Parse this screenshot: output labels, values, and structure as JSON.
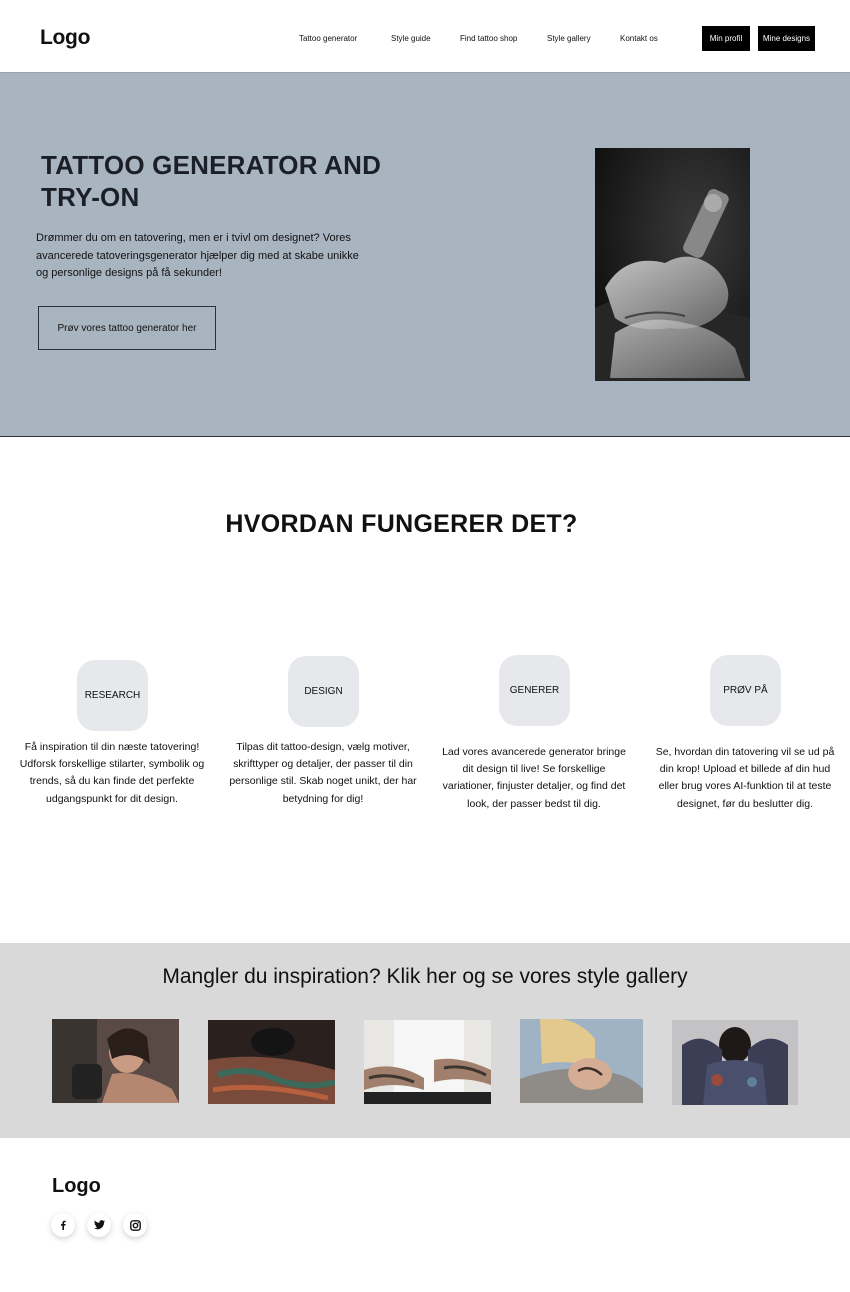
{
  "header": {
    "logo": "Logo",
    "nav": [
      "Tattoo generator",
      "Style guide",
      "Find tattoo shop",
      "Style gallery",
      "Kontakt os"
    ],
    "profile_button": "Min profil",
    "designs_button": "Mine designs"
  },
  "hero": {
    "title": "TATTOO GENERATOR AND TRY-ON",
    "text": "Drømmer du om en tatovering, men er i tvivl om designet? Vores avancerede tatoveringsgenerator hjælper dig med at skabe unikke og personlige designs på få sekunder!",
    "cta": "Prøv vores tattoo generator her"
  },
  "how": {
    "title": "HVORDAN FUNGERER DET?",
    "steps": [
      {
        "label": "RESEARCH",
        "text": "Få inspiration til din næste tatovering! Udforsk forskellige stilarter, symbolik og trends, så du kan finde det perfekte udgangspunkt for dit design."
      },
      {
        "label": "DESIGN",
        "text": "Tilpas dit tattoo-design, vælg motiver, skrifttyper og detaljer, der passer til din personlige stil. Skab noget unikt, der har betydning for dig!"
      },
      {
        "label": "GENERER",
        "text": "Lad vores avancerede generator bringe dit design til live! Se forskellige variationer, finjuster detaljer, og find det look, der passer bedst til dig."
      },
      {
        "label": "PRØV PÅ",
        "text": "Se, hvordan din tatovering vil se ud på din krop! Upload et billede af din hud eller brug vores AI-funktion til at teste designet, før du beslutter dig."
      }
    ]
  },
  "gallery": {
    "title": "Mangler du inspiration? Klik her og se vores style gallery"
  },
  "footer": {
    "logo": "Logo",
    "social": [
      "facebook-icon",
      "twitter-icon",
      "instagram-icon"
    ]
  },
  "colors": {
    "hero_bg": "#a9b4c1",
    "gallery_bg": "#d9d9d9",
    "step_badge": "#e6e8ec",
    "button_dark": "#000000"
  }
}
